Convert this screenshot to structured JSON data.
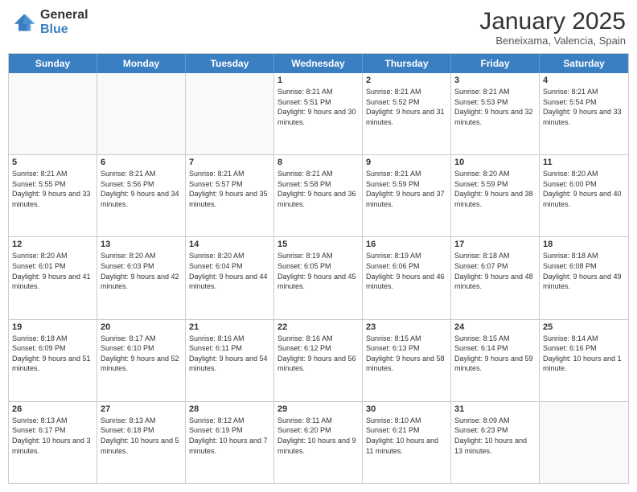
{
  "logo": {
    "general": "General",
    "blue": "Blue"
  },
  "header": {
    "month": "January 2025",
    "location": "Beneixama, Valencia, Spain"
  },
  "weekdays": [
    "Sunday",
    "Monday",
    "Tuesday",
    "Wednesday",
    "Thursday",
    "Friday",
    "Saturday"
  ],
  "rows": [
    [
      {
        "day": "",
        "empty": true
      },
      {
        "day": "",
        "empty": true
      },
      {
        "day": "",
        "empty": true
      },
      {
        "day": "1",
        "sunrise": "8:21 AM",
        "sunset": "5:51 PM",
        "daylight": "9 hours and 30 minutes."
      },
      {
        "day": "2",
        "sunrise": "8:21 AM",
        "sunset": "5:52 PM",
        "daylight": "9 hours and 31 minutes."
      },
      {
        "day": "3",
        "sunrise": "8:21 AM",
        "sunset": "5:53 PM",
        "daylight": "9 hours and 32 minutes."
      },
      {
        "day": "4",
        "sunrise": "8:21 AM",
        "sunset": "5:54 PM",
        "daylight": "9 hours and 33 minutes."
      }
    ],
    [
      {
        "day": "5",
        "sunrise": "8:21 AM",
        "sunset": "5:55 PM",
        "daylight": "9 hours and 33 minutes."
      },
      {
        "day": "6",
        "sunrise": "8:21 AM",
        "sunset": "5:56 PM",
        "daylight": "9 hours and 34 minutes."
      },
      {
        "day": "7",
        "sunrise": "8:21 AM",
        "sunset": "5:57 PM",
        "daylight": "9 hours and 35 minutes."
      },
      {
        "day": "8",
        "sunrise": "8:21 AM",
        "sunset": "5:58 PM",
        "daylight": "9 hours and 36 minutes."
      },
      {
        "day": "9",
        "sunrise": "8:21 AM",
        "sunset": "5:59 PM",
        "daylight": "9 hours and 37 minutes."
      },
      {
        "day": "10",
        "sunrise": "8:20 AM",
        "sunset": "5:59 PM",
        "daylight": "9 hours and 38 minutes."
      },
      {
        "day": "11",
        "sunrise": "8:20 AM",
        "sunset": "6:00 PM",
        "daylight": "9 hours and 40 minutes."
      }
    ],
    [
      {
        "day": "12",
        "sunrise": "8:20 AM",
        "sunset": "6:01 PM",
        "daylight": "9 hours and 41 minutes."
      },
      {
        "day": "13",
        "sunrise": "8:20 AM",
        "sunset": "6:03 PM",
        "daylight": "9 hours and 42 minutes."
      },
      {
        "day": "14",
        "sunrise": "8:20 AM",
        "sunset": "6:04 PM",
        "daylight": "9 hours and 44 minutes."
      },
      {
        "day": "15",
        "sunrise": "8:19 AM",
        "sunset": "6:05 PM",
        "daylight": "9 hours and 45 minutes."
      },
      {
        "day": "16",
        "sunrise": "8:19 AM",
        "sunset": "6:06 PM",
        "daylight": "9 hours and 46 minutes."
      },
      {
        "day": "17",
        "sunrise": "8:18 AM",
        "sunset": "6:07 PM",
        "daylight": "9 hours and 48 minutes."
      },
      {
        "day": "18",
        "sunrise": "8:18 AM",
        "sunset": "6:08 PM",
        "daylight": "9 hours and 49 minutes."
      }
    ],
    [
      {
        "day": "19",
        "sunrise": "8:18 AM",
        "sunset": "6:09 PM",
        "daylight": "9 hours and 51 minutes."
      },
      {
        "day": "20",
        "sunrise": "8:17 AM",
        "sunset": "6:10 PM",
        "daylight": "9 hours and 52 minutes."
      },
      {
        "day": "21",
        "sunrise": "8:16 AM",
        "sunset": "6:11 PM",
        "daylight": "9 hours and 54 minutes."
      },
      {
        "day": "22",
        "sunrise": "8:16 AM",
        "sunset": "6:12 PM",
        "daylight": "9 hours and 56 minutes."
      },
      {
        "day": "23",
        "sunrise": "8:15 AM",
        "sunset": "6:13 PM",
        "daylight": "9 hours and 58 minutes."
      },
      {
        "day": "24",
        "sunrise": "8:15 AM",
        "sunset": "6:14 PM",
        "daylight": "9 hours and 59 minutes."
      },
      {
        "day": "25",
        "sunrise": "8:14 AM",
        "sunset": "6:16 PM",
        "daylight": "10 hours and 1 minute."
      }
    ],
    [
      {
        "day": "26",
        "sunrise": "8:13 AM",
        "sunset": "6:17 PM",
        "daylight": "10 hours and 3 minutes."
      },
      {
        "day": "27",
        "sunrise": "8:13 AM",
        "sunset": "6:18 PM",
        "daylight": "10 hours and 5 minutes."
      },
      {
        "day": "28",
        "sunrise": "8:12 AM",
        "sunset": "6:19 PM",
        "daylight": "10 hours and 7 minutes."
      },
      {
        "day": "29",
        "sunrise": "8:11 AM",
        "sunset": "6:20 PM",
        "daylight": "10 hours and 9 minutes."
      },
      {
        "day": "30",
        "sunrise": "8:10 AM",
        "sunset": "6:21 PM",
        "daylight": "10 hours and 11 minutes."
      },
      {
        "day": "31",
        "sunrise": "8:09 AM",
        "sunset": "6:23 PM",
        "daylight": "10 hours and 13 minutes."
      },
      {
        "day": "",
        "empty": true
      }
    ]
  ]
}
